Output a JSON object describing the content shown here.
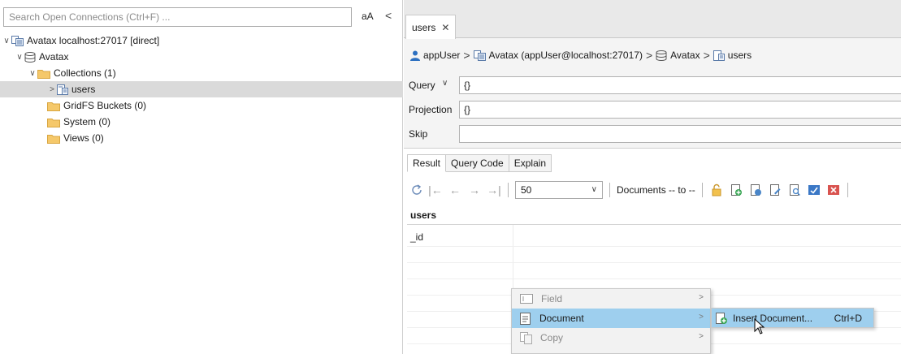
{
  "left_pane": {
    "search_placeholder": "Search Open Connections (Ctrl+F) ...",
    "case_toggle": "aA",
    "collapse_glyph": "<",
    "tree": {
      "connection": "Avatax localhost:27017 [direct]",
      "database": "Avatax",
      "collections": "Collections (1)",
      "collection_users": "users",
      "gridfs": "GridFS Buckets (0)",
      "system": "System (0)",
      "views": "Views (0)"
    }
  },
  "tab": {
    "label": "users",
    "close": "✕"
  },
  "breadcrumb": {
    "user": "appUser",
    "connection": "Avatax (appUser@localhost:27017)",
    "database": "Avatax",
    "collection": "users",
    "separator": ">"
  },
  "query_form": {
    "query_label": "Query",
    "query_value": "{}",
    "projection_label": "Projection",
    "projection_value": "{}",
    "skip_label": "Skip",
    "skip_value": ""
  },
  "result_tabs": [
    "Result",
    "Query Code",
    "Explain"
  ],
  "toolbar": {
    "page_size": "50",
    "documents_text": "Documents -- to --"
  },
  "collection_label": "users",
  "grid": {
    "column_header": "_id"
  },
  "context_menu": {
    "items": [
      {
        "label": "Field",
        "icon": "field-icon"
      },
      {
        "label": "Document",
        "icon": "document-icon"
      },
      {
        "label": "Copy",
        "icon": "copy-icon"
      }
    ],
    "submenu": {
      "label": "Insert Document...",
      "shortcut": "Ctrl+D"
    }
  },
  "colors": {
    "highlight": "#9ecfee",
    "folder": "#f5c86a",
    "user_icon": "#2b6fc0",
    "delete_icon": "#d9534f"
  }
}
